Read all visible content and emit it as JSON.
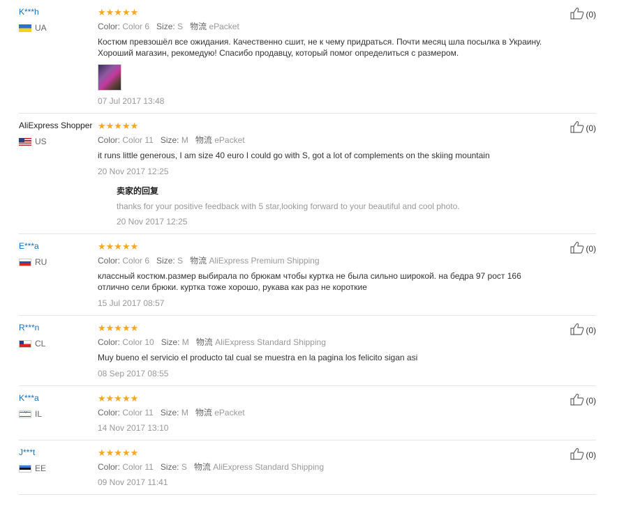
{
  "labels": {
    "color": "Color:",
    "size": "Size:",
    "shipping": "物流"
  },
  "reviews": [
    {
      "name": "K***h",
      "named_link": true,
      "country": "UA",
      "color": "Color 6",
      "size": "S",
      "shipping": "ePacket",
      "text": "Костюм превзошёл все ожидания. Качественно сшит, не к чему придраться. Почти месяц шла посылка в Украину. Хороший магазин, рекомедую! Спасибо продавцу, который помог определиться с размером.",
      "has_photo": true,
      "date": "07 Jul 2017 13:48",
      "useful": "(0)"
    },
    {
      "name": "AliExpress Shopper",
      "named_link": false,
      "country": "US",
      "color": "Color 11",
      "size": "M",
      "shipping": "ePacket",
      "text": "it runs little generous, I am size 40 euro I could go with S, got a lot of complements on the skiing mountain",
      "date": "20 Nov 2017 12:25",
      "useful": "(0)",
      "reply": {
        "title": "卖家的回复",
        "text": "thanks for your positive feedback with 5 star,looking forward to your beautiful and cool photo.",
        "date": "20 Nov 2017 12:25"
      }
    },
    {
      "name": "E***a",
      "named_link": true,
      "country": "RU",
      "color": "Color 6",
      "size": "S",
      "shipping": "AliExpress Premium Shipping",
      "text": "классный костюм.размер выбирала по брюкам чтобы куртка не была сильно широкой. на бедра 97 рост 166 отлично сели брюки. куртка тоже хорошо, рукава как раз не короткие",
      "date": "15 Jul 2017 08:57",
      "useful": "(0)"
    },
    {
      "name": "R***n",
      "named_link": true,
      "country": "CL",
      "color": "Color 10",
      "size": "M",
      "shipping": "AliExpress Standard Shipping",
      "text": "Muy bueno el servicio el producto tal cual se muestra en la pagina los felicito sigan asi",
      "date": "08 Sep 2017 08:55",
      "useful": "(0)"
    },
    {
      "name": "K***a",
      "named_link": true,
      "country": "IL",
      "color": "Color 11",
      "size": "M",
      "shipping": "ePacket",
      "text": "",
      "date": "14 Nov 2017 13:10",
      "useful": "(0)"
    },
    {
      "name": "J***t",
      "named_link": true,
      "country": "EE",
      "color": "Color 11",
      "size": "S",
      "shipping": "AliExpress Standard Shipping",
      "text": "",
      "date": "09 Nov 2017 11:41",
      "useful": "(0)"
    }
  ],
  "rating_stars": "★★★★★",
  "colors": {
    "link": "#1a6fb5",
    "star": "#f5a623",
    "muted": "#999999"
  }
}
